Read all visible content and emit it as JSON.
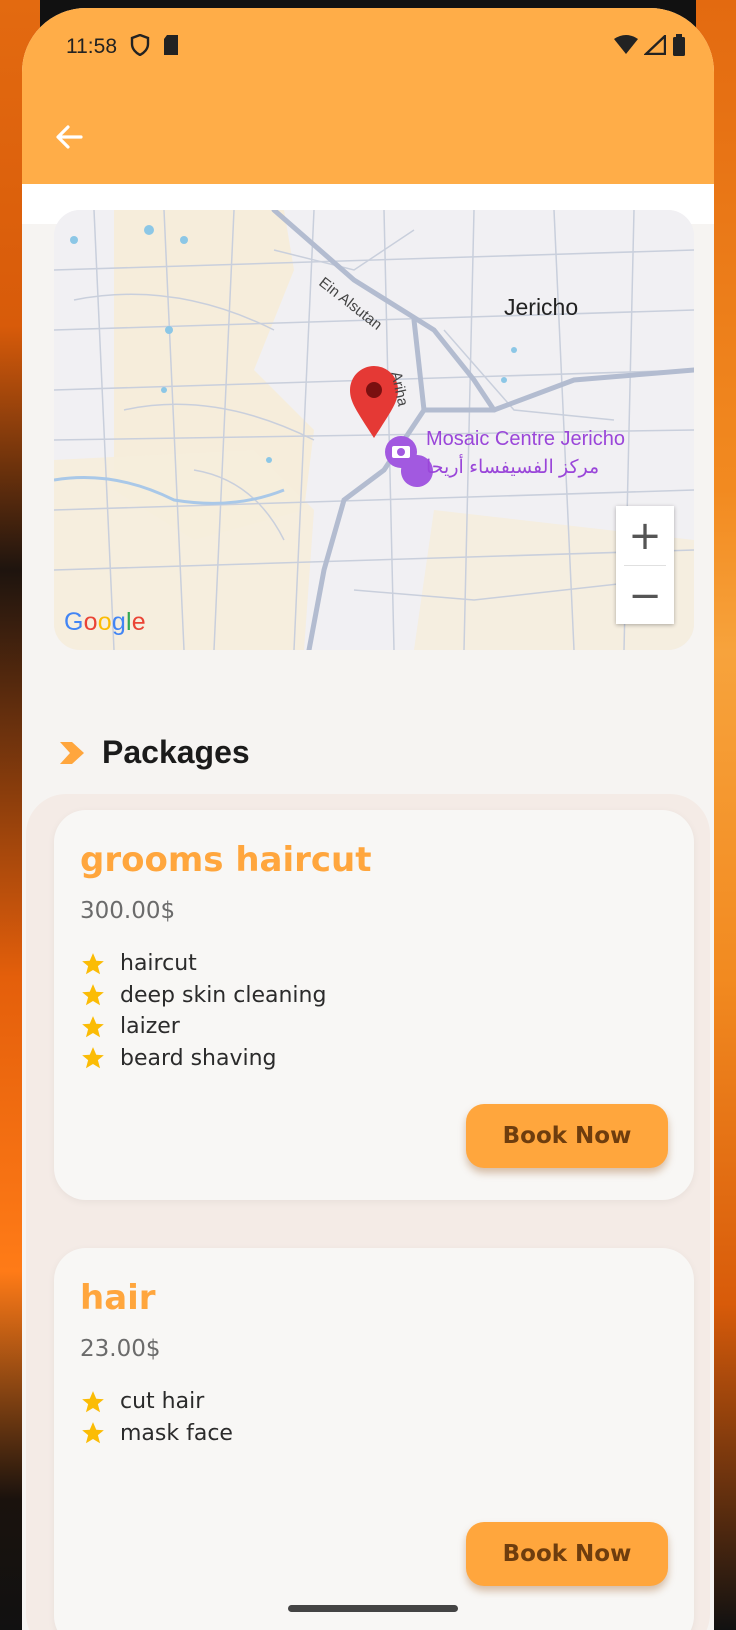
{
  "status_bar": {
    "time": "11:58"
  },
  "map": {
    "labels": {
      "city": "Jericho",
      "road1": "Ein Alsutan",
      "road2": "Ariha",
      "poi_en": "Mosaic Centre Jericho",
      "poi_ar": "مركز الفسيفساء أريحا"
    },
    "zoom_in": "+",
    "zoom_out": "−",
    "attribution": [
      "G",
      "o",
      "o",
      "g",
      "l",
      "e"
    ],
    "attribution_colors": [
      "#4285F4",
      "#EA4335",
      "#FBBC05",
      "#4285F4",
      "#34A853",
      "#EA4335"
    ]
  },
  "section": {
    "title": "Packages"
  },
  "colors": {
    "accent": "#ffa63d",
    "appbar": "#ffad48",
    "star": "#fbbc05"
  },
  "packages": [
    {
      "name": "grooms haircut",
      "price": "300.00$",
      "features": [
        "haircut",
        "deep skin cleaning",
        "laizer",
        "beard shaving"
      ],
      "button": "Book Now"
    },
    {
      "name": "hair",
      "price": "23.00$",
      "features": [
        "cut hair",
        "mask face"
      ],
      "button": "Book Now"
    }
  ]
}
